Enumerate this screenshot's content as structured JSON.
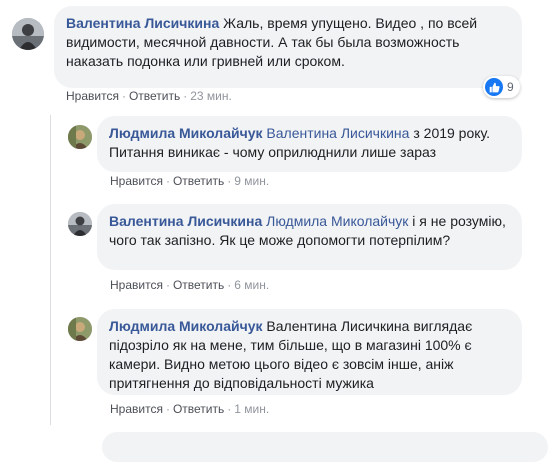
{
  "comments": [
    {
      "author": "Валентина Лисичкина",
      "mention": "",
      "text": "Жаль, время упущено. Видео , по всей видимости, месячной давности. А так бы была возможность наказать подонка или гривней или сроком.",
      "like_label": "Нравится",
      "reply_label": "Ответить",
      "separator": "·",
      "time": "23 мин.",
      "reaction": {
        "icon": "thumbs-up-icon",
        "count": "9",
        "color": "#1877f2"
      }
    },
    {
      "author": "Людмила Миколайчук",
      "mention": "Валентина Лисичкина",
      "text": " з 2019 року. Питання виникає - чому оприлюднили лише зараз",
      "like_label": "Нравится",
      "reply_label": "Ответить",
      "separator": "·",
      "time": "9 мин."
    },
    {
      "author": "Валентина Лисичкина",
      "mention": "Людмила Миколайчук",
      "text": " і я не розумію, чого так запізно. Як це може допомогти потерпілим?",
      "like_label": "Нравится",
      "reply_label": "Ответить",
      "separator": "·",
      "time": "6 мин."
    },
    {
      "author": "Людмила Миколайчук",
      "mention": "",
      "text": "Валентина Лисичкина виглядає підозріло як на мене, тим більше, що в магазині 100% є камери. Видно метою цього відео є зовсім інше, аніж притягнення до відповідальності мужика",
      "like_label": "Нравится",
      "reply_label": "Ответить",
      "separator": "·",
      "time": "1 мин."
    }
  ],
  "colors": {
    "author": "#385898",
    "bubble": "#f2f3f5",
    "meta": "#90949c"
  }
}
